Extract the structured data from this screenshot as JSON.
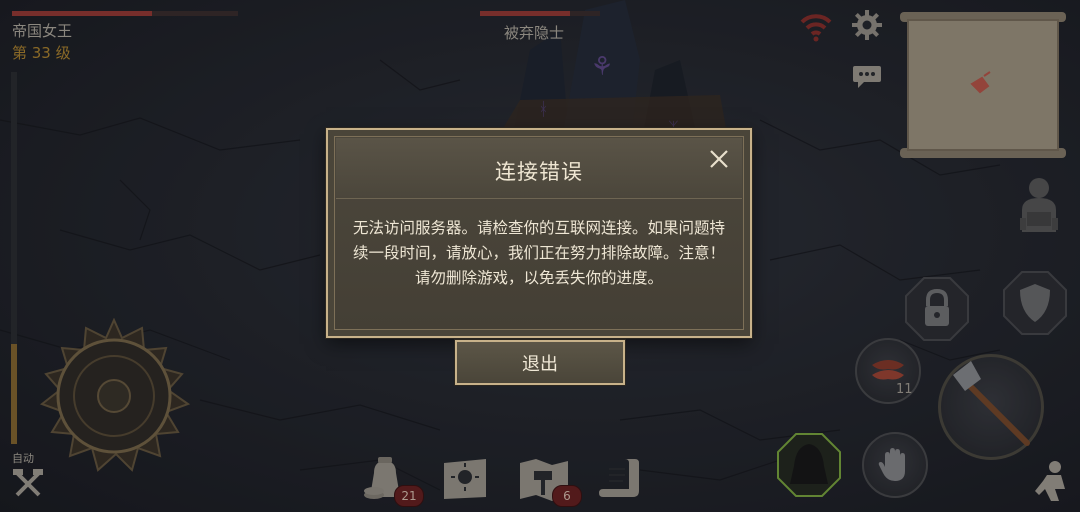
{
  "player": {
    "name": "帝国女王",
    "level": "第 33 级",
    "health": 0.62,
    "side_meter": 0.27
  },
  "enemy": {
    "name": "被弃隐士",
    "health": 0.75
  },
  "controls": {
    "auto_label": "自动"
  },
  "bottom_bar": {
    "inventory_count": "21",
    "blueprints_count": "6"
  },
  "quick_slot": {
    "item_count": "11"
  },
  "dialog": {
    "title": "连接错误",
    "message": "无法访问服务器。请检查你的互联网连接。如果问题持续一段时间，请放心，我们正在努力排除故障。注意！请勿删除游戏，以免丢失你的进度。",
    "exit_label": "退出"
  },
  "icons": {
    "wifi": "wifi-icon",
    "settings": "gear-icon",
    "chat": "chat-icon",
    "map": "map-scroll",
    "backpack": "backpack-icon",
    "lock": "lock-icon",
    "shield": "shield-icon",
    "meat": "meat-icon",
    "axe": "axe-icon",
    "hood": "hood-icon",
    "hand": "hand-icon",
    "crouch": "crouch-icon",
    "craft": "crossed-tools-icon",
    "joystick": "joystick",
    "inventory": "bag-icon",
    "skills": "sun-book-icon",
    "blueprints": "map-hammer-icon",
    "quests": "scroll-icon",
    "close": "close-icon"
  },
  "colors": {
    "accent_gold": "#c8b28a",
    "health_red": "#9b3a35",
    "wifi_red": "#8b2e2a",
    "hood_green": "#7fae3f"
  }
}
